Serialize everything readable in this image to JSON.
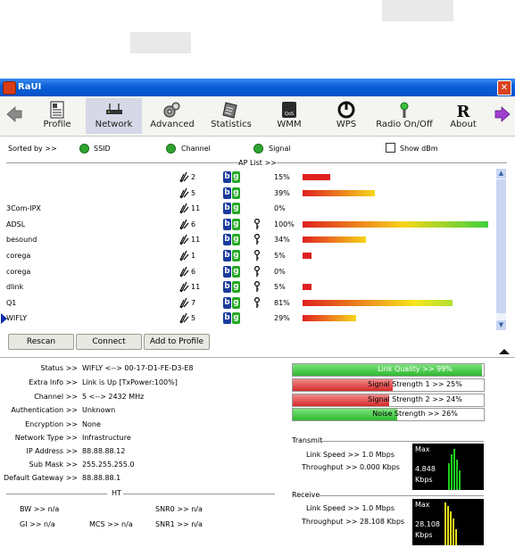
{
  "window": {
    "title": "RaUI",
    "close_glyph": "✕"
  },
  "toolbar": {
    "items": [
      {
        "label": "Profile",
        "icon": "profile-icon"
      },
      {
        "label": "Network",
        "icon": "network-icon",
        "active": true
      },
      {
        "label": "Advanced",
        "icon": "advanced-icon"
      },
      {
        "label": "Statistics",
        "icon": "statistics-icon"
      },
      {
        "label": "WMM",
        "icon": "wmm-icon"
      },
      {
        "label": "WPS",
        "icon": "wps-icon"
      },
      {
        "label": "Radio On/Off",
        "icon": "radio-icon"
      },
      {
        "label": "About",
        "icon": "about-icon"
      }
    ]
  },
  "sort": {
    "label": "Sorted by >>",
    "ssid": "SSID",
    "channel": "Channel",
    "signal": "Signal",
    "show_dbm": "Show dBm"
  },
  "aplist": {
    "title": "AP List >>",
    "rows": [
      {
        "ssid": "",
        "channel": "2",
        "secure": false,
        "signal": "15%",
        "value": 15
      },
      {
        "ssid": "",
        "channel": "5",
        "secure": false,
        "signal": "39%",
        "value": 39
      },
      {
        "ssid": "3Com-IPX",
        "channel": "11",
        "secure": false,
        "signal": "0%",
        "value": 0
      },
      {
        "ssid": "ADSL",
        "channel": "6",
        "secure": true,
        "signal": "100%",
        "value": 100
      },
      {
        "ssid": "besound",
        "channel": "11",
        "secure": true,
        "signal": "34%",
        "value": 34
      },
      {
        "ssid": "corega",
        "channel": "1",
        "secure": true,
        "signal": "5%",
        "value": 5
      },
      {
        "ssid": "corega",
        "channel": "6",
        "secure": true,
        "signal": "0%",
        "value": 0
      },
      {
        "ssid": "dlink",
        "channel": "11",
        "secure": true,
        "signal": "5%",
        "value": 5
      },
      {
        "ssid": "Q1",
        "channel": "7",
        "secure": true,
        "signal": "81%",
        "value": 81
      },
      {
        "ssid": "WIFLY",
        "channel": "5",
        "secure": false,
        "signal": "29%",
        "value": 29,
        "selected": true
      }
    ]
  },
  "actions": {
    "rescan": "Rescan",
    "connect": "Connect",
    "add_profile": "Add to Profile"
  },
  "status": {
    "status_lbl": "Status >>",
    "status_val": "WIFLY <--> 00-17-D1-FE-D3-E8",
    "extra_lbl": "Extra Info >>",
    "extra_val": "Link is Up [TxPower:100%]",
    "channel_lbl": "Channel >>",
    "channel_val": "5 <--> 2432 MHz",
    "auth_lbl": "Authentication >>",
    "auth_val": "Unknown",
    "enc_lbl": "Encryption >>",
    "enc_val": "None",
    "ntype_lbl": "Network Type >>",
    "ntype_val": "Infrastructure",
    "ip_lbl": "IP Address >>",
    "ip_val": "88.88.88.12",
    "mask_lbl": "Sub Mask >>",
    "mask_val": "255.255.255.0",
    "gw_lbl": "Default Gateway >>",
    "gw_val": "88.88.88.1"
  },
  "ht": {
    "title": "HT",
    "bw": "BW >> n/a",
    "gi": "GI >> n/a",
    "mcs": "MCS >> n/a",
    "snr0": "SNR0 >> n/a",
    "snr1": "SNR1 >> n/a"
  },
  "quality": {
    "link_quality": "Link Quality >> 99%",
    "link_quality_value": 99,
    "sig1": "Signal Strength 1 >> 25%",
    "sig1_value": 25,
    "sig2": "Signal Strength 2 >> 24%",
    "sig2_value": 24,
    "noise": "Noise Strength >> 26%",
    "noise_value": 26
  },
  "transmit": {
    "title": "Transmit",
    "link_speed": "Link Speed >> 1.0 Mbps",
    "throughput": "Throughput >> 0.000 Kbps",
    "graph_max": "Max",
    "graph_value": "4.848",
    "graph_unit": "Kbps"
  },
  "receive": {
    "title": "Receive",
    "link_speed": "Link Speed >> 1.0 Mbps",
    "throughput": "Throughput >> 28.108 Kbps",
    "graph_max": "Max",
    "graph_value": "28.108",
    "graph_unit": "Kbps"
  },
  "colors": {
    "title_bar": "#0a5fd8",
    "active_tab": "#d6d8e8",
    "b_badge": "#1a3a9c",
    "g_badge": "#26a826"
  }
}
